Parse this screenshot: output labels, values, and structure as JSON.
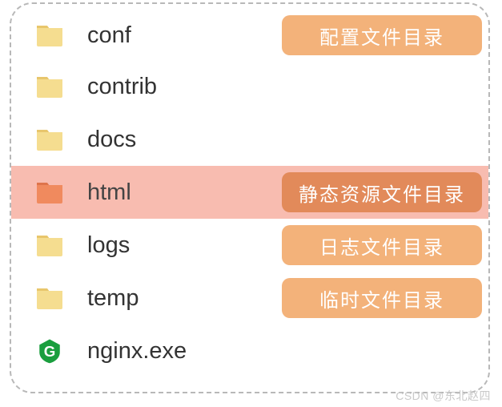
{
  "rows": [
    {
      "name": "conf",
      "type": "folder",
      "annotation": "配置文件目录",
      "selected": false
    },
    {
      "name": "contrib",
      "type": "folder",
      "annotation": "",
      "selected": false
    },
    {
      "name": "docs",
      "type": "folder",
      "annotation": "",
      "selected": false
    },
    {
      "name": "html",
      "type": "folder",
      "annotation": "静态资源文件目录",
      "selected": true
    },
    {
      "name": "logs",
      "type": "folder",
      "annotation": "日志文件目录",
      "selected": false
    },
    {
      "name": "temp",
      "type": "folder",
      "annotation": "临时文件目录",
      "selected": false
    },
    {
      "name": "nginx.exe",
      "type": "app",
      "annotation": "",
      "selected": false
    }
  ],
  "watermark": "CSDN @东北赵四"
}
